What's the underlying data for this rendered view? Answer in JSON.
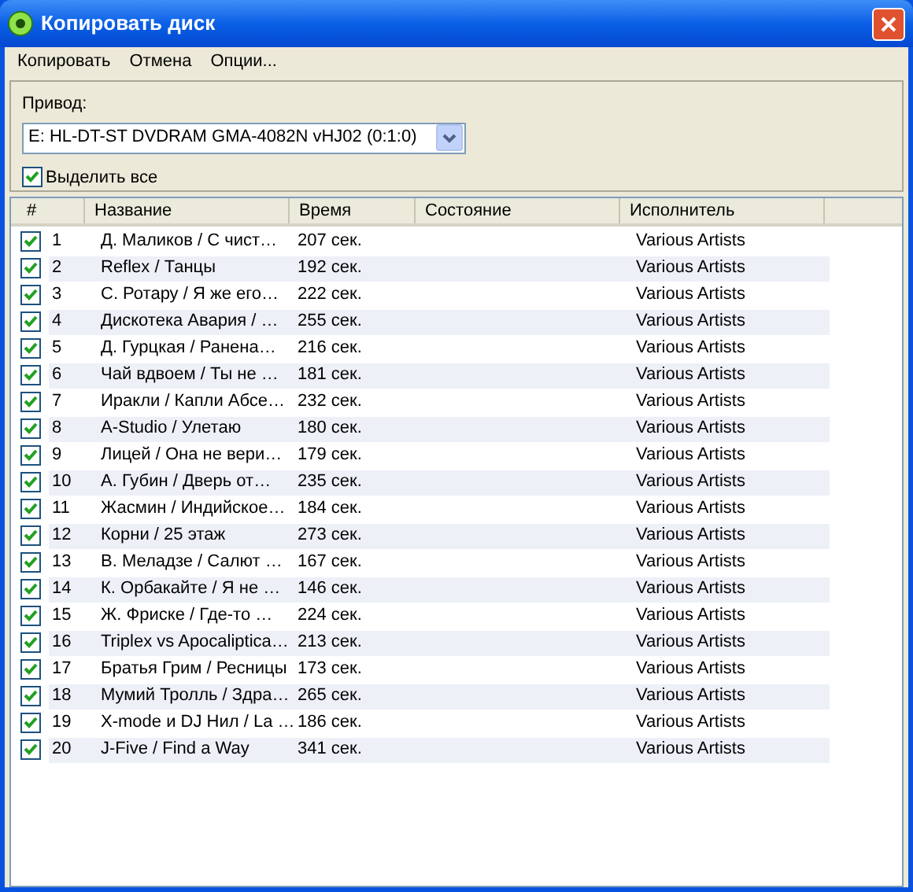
{
  "window": {
    "title": "Копировать диск"
  },
  "menu": [
    "Копировать",
    "Отмена",
    "Опции..."
  ],
  "drive": {
    "label": "Привод:",
    "value": "E: HL-DT-ST DVDRAM GMA-4082N vHJ02 (0:1:0)"
  },
  "select_all": {
    "label": "Выделить все",
    "checked": true
  },
  "table": {
    "columns": [
      "#",
      "Название",
      "Время",
      "Состояние",
      "Исполнитель"
    ],
    "rows": [
      {
        "checked": true,
        "num": "1",
        "title": "Д. Маликов / С чист…",
        "time": "207 сек.",
        "artist": "Various Artists"
      },
      {
        "checked": true,
        "num": "2",
        "title": "Reflex / Танцы",
        "time": "192 сек.",
        "artist": "Various Artists"
      },
      {
        "checked": true,
        "num": "3",
        "title": "С. Ротару / Я же его…",
        "time": "222 сек.",
        "artist": "Various Artists"
      },
      {
        "checked": true,
        "num": "4",
        "title": "Дискотека Авария / …",
        "time": "255 сек.",
        "artist": "Various Artists"
      },
      {
        "checked": true,
        "num": "5",
        "title": "Д. Гурцкая / Ранена…",
        "time": "216 сек.",
        "artist": "Various Artists"
      },
      {
        "checked": true,
        "num": "6",
        "title": "Чай вдвоем / Ты не …",
        "time": "181 сек.",
        "artist": "Various Artists"
      },
      {
        "checked": true,
        "num": "7",
        "title": "Иракли / Капли Абсе…",
        "time": "232 сек.",
        "artist": "Various Artists"
      },
      {
        "checked": true,
        "num": "8",
        "title": "A-Studio / Улетаю",
        "time": "180 сек.",
        "artist": "Various Artists"
      },
      {
        "checked": true,
        "num": "9",
        "title": "Лицей / Она не вери…",
        "time": "179 сек.",
        "artist": "Various Artists"
      },
      {
        "checked": true,
        "num": "10",
        "title": "А. Губин / Дверь от…",
        "time": "235 сек.",
        "artist": "Various Artists"
      },
      {
        "checked": true,
        "num": "11",
        "title": "Жасмин / Индийское…",
        "time": "184 сек.",
        "artist": "Various Artists"
      },
      {
        "checked": true,
        "num": "12",
        "title": "Корни / 25 этаж",
        "time": "273 сек.",
        "artist": "Various Artists"
      },
      {
        "checked": true,
        "num": "13",
        "title": "В. Меладзе / Салют …",
        "time": "167 сек.",
        "artist": "Various Artists"
      },
      {
        "checked": true,
        "num": "14",
        "title": "К. Орбакайте / Я не …",
        "time": "146 сек.",
        "artist": "Various Artists"
      },
      {
        "checked": true,
        "num": "15",
        "title": "Ж. Фриске / Где-то …",
        "time": "224 сек.",
        "artist": "Various Artists"
      },
      {
        "checked": true,
        "num": "16",
        "title": "Triplex vs Apocaliptica…",
        "time": "213 сек.",
        "artist": "Various Artists"
      },
      {
        "checked": true,
        "num": "17",
        "title": "Братья Грим / Ресницы",
        "time": "173 сек.",
        "artist": "Various Artists"
      },
      {
        "checked": true,
        "num": "18",
        "title": "Мумий Тролль / Здра…",
        "time": "265 сек.",
        "artist": "Various Artists"
      },
      {
        "checked": true,
        "num": "19",
        "title": "X-mode и DJ Нил / La …",
        "time": "186 сек.",
        "artist": "Various Artists"
      },
      {
        "checked": true,
        "num": "20",
        "title": "J-Five / Find a Way",
        "time": "341 сек.",
        "artist": "Various Artists"
      }
    ]
  }
}
